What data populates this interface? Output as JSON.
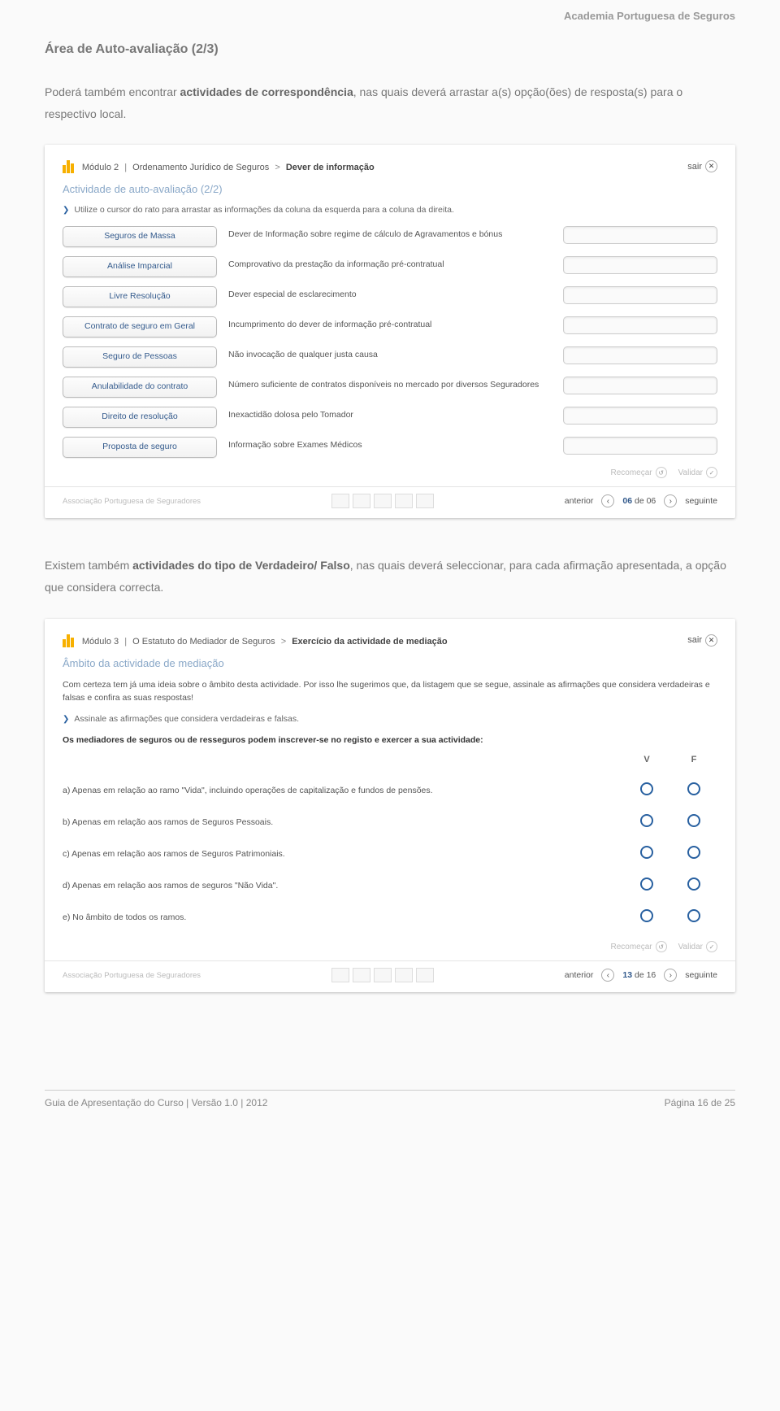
{
  "header": {
    "brand": "Academia Portuguesa de Seguros"
  },
  "section_title": "Área de Auto-avaliação (2/3)",
  "para1_prefix": "Poderá também encontrar ",
  "para1_bold": "actividades de correspondência",
  "para1_suffix": ", nas quais deverá arrastar a(s) opção(ões) de resposta(s) para o respectivo local.",
  "para2_prefix": "Existem também ",
  "para2_bold": "actividades do tipo de Verdadeiro/ Falso",
  "para2_suffix": ", nas quais deverá seleccionar, para cada afirmação apresentada, a opção que considera correcta.",
  "card1": {
    "breadcrumb_module": "Módulo 2",
    "breadcrumb_sep": "|",
    "breadcrumb_path": "Ordenamento Jurídico de Seguros",
    "breadcrumb_arrow": ">",
    "breadcrumb_current": "Dever de informação",
    "sair": "sair",
    "activity_title": "Actividade de auto-avaliação (2/2)",
    "instruction": "Utilize o cursor do rato para arrastar as informações da coluna da esquerda para a coluna da direita.",
    "rows": [
      {
        "left": "Seguros de Massa",
        "mid": "Dever de Informação sobre regime de cálculo de Agravamentos e bónus"
      },
      {
        "left": "Análise Imparcial",
        "mid": "Comprovativo da prestação da informação pré-contratual"
      },
      {
        "left": "Livre Resolução",
        "mid": "Dever especial de esclarecimento"
      },
      {
        "left": "Contrato de seguro em Geral",
        "mid": "Incumprimento do dever de informação pré-contratual"
      },
      {
        "left": "Seguro de Pessoas",
        "mid": "Não invocação de qualquer justa causa"
      },
      {
        "left": "Anulabilidade do contrato",
        "mid": "Número suficiente de contratos disponíveis no mercado por diversos Seguradores"
      },
      {
        "left": "Direito de resolução",
        "mid": "Inexactidão dolosa pelo Tomador"
      },
      {
        "left": "Proposta de seguro",
        "mid": "Informação sobre Exames Médicos"
      }
    ],
    "action_retry": "Recomeçar",
    "action_validate": "Validar",
    "assoc": "Associação Portuguesa de Seguradores",
    "prev": "anterior",
    "page_num": "06",
    "page_de": "de 06",
    "next": "seguinte"
  },
  "card2": {
    "breadcrumb_module": "Módulo 3",
    "breadcrumb_sep": "|",
    "breadcrumb_path": "O Estatuto do Mediador de Seguros",
    "breadcrumb_arrow": ">",
    "breadcrumb_current": "Exercício da actividade de mediação",
    "sair": "sair",
    "activity_title": "Âmbito da actividade de mediação",
    "intro": "Com certeza tem já uma ideia sobre o âmbito desta actividade. Por isso lhe sugerimos que, da listagem que se segue, assinale as afirmações que considera verdadeiras e falsas e confira as suas respostas!",
    "instruction": "Assinale as afirmações que considera verdadeiras e falsas.",
    "question": "Os mediadores de seguros ou de resseguros podem inscrever-se no registo e exercer a sua actividade:",
    "col_v": "V",
    "col_f": "F",
    "rows": [
      "a) Apenas em relação ao ramo \"Vida\", incluindo operações de capitalização e fundos de pensões.",
      "b) Apenas em relação aos ramos de Seguros Pessoais.",
      "c) Apenas em relação aos ramos de  Seguros Patrimoniais.",
      "d) Apenas em relação aos ramos de seguros \"Não Vida\".",
      "e) No âmbito de todos os ramos."
    ],
    "action_retry": "Recomeçar",
    "action_validate": "Validar",
    "assoc": "Associação Portuguesa de Seguradores",
    "prev": "anterior",
    "page_num": "13",
    "page_de": "de 16",
    "next": "seguinte"
  },
  "footer": {
    "left": "Guia de Apresentação do Curso | Versão 1.0 | 2012",
    "right": "Página 16 de 25"
  }
}
